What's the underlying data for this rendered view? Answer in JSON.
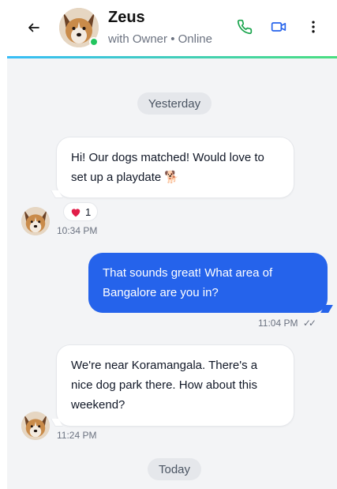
{
  "header": {
    "title": "Zeus",
    "subtitle": "with Owner • Online",
    "status": "online",
    "colors": {
      "online": "#22c55e",
      "call": "#16a34a",
      "video": "#2563eb"
    },
    "icons": {
      "back": "arrow-left-icon",
      "call": "phone-icon",
      "video": "video-camera-icon",
      "menu": "more-vertical-icon"
    }
  },
  "chat": {
    "date_yesterday": "Yesterday",
    "date_today": "Today",
    "messages": [
      {
        "direction": "incoming",
        "line1": "Hi! Our dogs matched! Would love to",
        "line2": "set up a playdate 🐕",
        "time": "10:34 PM",
        "reaction": {
          "emoji": "heart",
          "count": "1"
        }
      },
      {
        "direction": "outgoing",
        "line1": "That sounds great! What area of",
        "line2": "Bangalore are you in?",
        "time": "11:04 PM",
        "status": "✓✓"
      },
      {
        "direction": "incoming",
        "line1": "We're near Koramangala. There's a",
        "line2": "nice dog park there. How about this",
        "line3": "weekend?",
        "time": "11:24 PM"
      }
    ]
  }
}
